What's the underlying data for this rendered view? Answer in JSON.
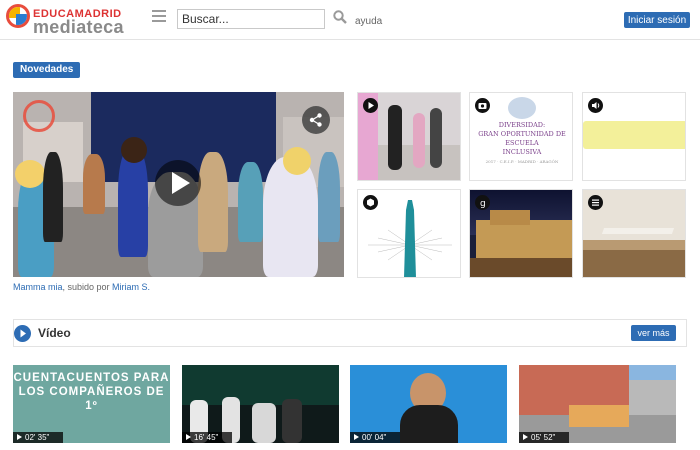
{
  "header": {
    "logo_top": "EDUCAMADRID",
    "logo_bottom": "mediateca",
    "search_placeholder": "Buscar...",
    "help_label": "ayuda",
    "login_label": "Iniciar sesión"
  },
  "novedades": {
    "badge": "Novedades",
    "featured": {
      "title": "Mamma mia",
      "uploaded_by_text": ", subido por ",
      "author": "Miriam S."
    },
    "thumbs": [
      {
        "type_icon": "play-icon"
      },
      {
        "type_icon": "camera-icon"
      },
      {
        "type_icon": "audio-icon",
        "text": ""
      },
      {
        "type_icon": "cube-icon"
      },
      {
        "type_icon": "geogebra-icon"
      },
      {
        "type_icon": "list-icon"
      }
    ],
    "poster_text": {
      "line1": "DIVERSIDAD:",
      "line2": "GRAN OPORTUNIDAD DE ESCUELA",
      "line3": "INCLUSIVA",
      "line4": "2017 · C.E.I.P. · MADRID · ARAGÓN"
    }
  },
  "video_section": {
    "title": "Vídeo",
    "more_label": "ver más",
    "items": [
      {
        "duration": "02' 35\"",
        "text": "CUENTACUENTOS PARA LOS COMPAÑEROS DE 1º"
      },
      {
        "duration": "16' 45\""
      },
      {
        "duration": "00' 04\""
      },
      {
        "duration": "05' 52\""
      }
    ]
  },
  "colors": {
    "accent": "#2d6cb4",
    "logo_red": "#d33333"
  }
}
